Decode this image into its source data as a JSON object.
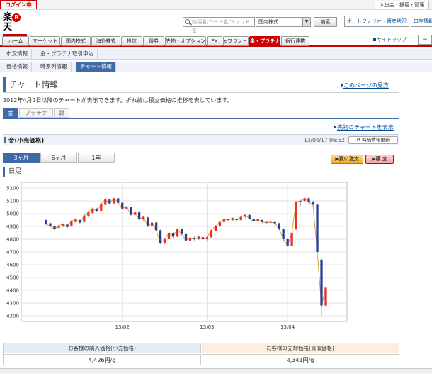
{
  "topbar": {
    "login": "ログイン中",
    "toplink": "入出金・振替・管理"
  },
  "header": {
    "logo_main": "楽",
    "logo_r": "R",
    "logo_end": "天",
    "search_placeholder": "銘柄名/コード名/ファンド名",
    "market_select": "国内株式",
    "search_button": "検索",
    "portfolio_tab": "ポートフォリオ・資産状況",
    "account_tab": "口座情報"
  },
  "nav": {
    "items": [
      "ホーム",
      "マーケット",
      "国内株式",
      "海外株式",
      "投信",
      "債券",
      "先物・オプション",
      "FX",
      "eワラント",
      "金・プラチナ",
      "銀行連携"
    ],
    "sitemap": "サイトマップ",
    "minimize": "−"
  },
  "subnav1": [
    "市況情報",
    "金・プラチナ取引申込"
  ],
  "subnav2": [
    "価格情報",
    "時系列情報",
    "チャート情報"
  ],
  "page": {
    "title": "チャート情報",
    "help_link": "このページの見方",
    "description": "2012年4月2日以降のチャートが表示できます。折れ線は積立価格の推移を表しています。"
  },
  "metal_tabs": [
    "金",
    "プラチナ",
    "銀"
  ],
  "futures_link": "先物のチャートを表示",
  "product": {
    "name": "金(小売価格)",
    "timestamp": "13/04/17 06:52",
    "refresh": "時価情報更新"
  },
  "period_tabs": [
    "3ヶ月",
    "6ヶ月",
    "1年"
  ],
  "buttons": {
    "buy": "買い注文",
    "accumulate": "積 立"
  },
  "chart_label": "日足",
  "chart_data": {
    "type": "candlestick",
    "ylim": [
      4200,
      5200
    ],
    "yticks": [
      4200,
      4300,
      4400,
      4500,
      4600,
      4700,
      4800,
      4900,
      5000,
      5100,
      5200
    ],
    "xlabels": [
      {
        "label": "13/02",
        "index": 18
      },
      {
        "label": "13/03",
        "index": 38
      },
      {
        "label": "13/04",
        "index": 57
      }
    ],
    "candles": [
      [
        4950,
        4920,
        4960,
        4910
      ],
      [
        4925,
        4900,
        4935,
        4890
      ],
      [
        4900,
        4880,
        4910,
        4870
      ],
      [
        4890,
        4905,
        4915,
        4880
      ],
      [
        4905,
        4920,
        4925,
        4895
      ],
      [
        4915,
        4895,
        4925,
        4885
      ],
      [
        4900,
        4940,
        4950,
        4895
      ],
      [
        4935,
        4955,
        4965,
        4925
      ],
      [
        4950,
        4930,
        4960,
        4920
      ],
      [
        4935,
        4985,
        4995,
        4930
      ],
      [
        4980,
        5010,
        5020,
        4970
      ],
      [
        5005,
        5040,
        5050,
        5000
      ],
      [
        5040,
        5020,
        5045,
        5010
      ],
      [
        5020,
        5075,
        5085,
        5015
      ],
      [
        5070,
        5110,
        5120,
        5065
      ],
      [
        5110,
        5080,
        5115,
        5070
      ],
      [
        5080,
        5120,
        5125,
        5075
      ],
      [
        5120,
        5085,
        5125,
        5075
      ],
      [
        5085,
        5040,
        5090,
        5030
      ],
      [
        5040,
        5055,
        5060,
        5030
      ],
      [
        5050,
        4990,
        5055,
        4985
      ],
      [
        4990,
        5010,
        5020,
        4980
      ],
      [
        5010,
        4955,
        5015,
        4950
      ],
      [
        4955,
        4975,
        4980,
        4945
      ],
      [
        4970,
        4900,
        4975,
        4895
      ],
      [
        4900,
        4930,
        4935,
        4890
      ],
      [
        4930,
        4870,
        4935,
        4860
      ],
      [
        4870,
        4770,
        4875,
        4760
      ],
      [
        4770,
        4800,
        4810,
        4760
      ],
      [
        4800,
        4850,
        4860,
        4795
      ],
      [
        4845,
        4820,
        4855,
        4810
      ],
      [
        4820,
        4880,
        4885,
        4815
      ],
      [
        4880,
        4840,
        4885,
        4830
      ],
      [
        4840,
        4790,
        4845,
        4780
      ],
      [
        4790,
        4810,
        4815,
        4785
      ],
      [
        4810,
        4800,
        4820,
        4790
      ],
      [
        4800,
        4820,
        4830,
        4795
      ],
      [
        4815,
        4800,
        4825,
        4795
      ],
      [
        4800,
        4815,
        4825,
        4790
      ],
      [
        4815,
        4870,
        4880,
        4810
      ],
      [
        4865,
        4900,
        4910,
        4860
      ],
      [
        4900,
        4935,
        4945,
        4895
      ],
      [
        4935,
        4955,
        4965,
        4925
      ],
      [
        4955,
        4950,
        4960,
        4940
      ],
      [
        4950,
        4965,
        4970,
        4940
      ],
      [
        4960,
        4950,
        4970,
        4940
      ],
      [
        4950,
        4975,
        4980,
        4940
      ],
      [
        4975,
        4990,
        5000,
        4965
      ],
      [
        4990,
        4960,
        4995,
        4955
      ],
      [
        4960,
        4940,
        4965,
        4930
      ],
      [
        4940,
        4955,
        4960,
        4935
      ],
      [
        4950,
        4935,
        4960,
        4925
      ],
      [
        4935,
        4930,
        4945,
        4920
      ],
      [
        4930,
        4935,
        4945,
        4920
      ],
      [
        4935,
        4925,
        4940,
        4920
      ],
      [
        4925,
        4880,
        4930,
        4870
      ],
      [
        4880,
        4800,
        4885,
        4780
      ],
      [
        4800,
        4750,
        4810,
        4740
      ],
      [
        4750,
        4850,
        4860,
        4745
      ],
      [
        4880,
        5090,
        5100,
        4870
      ],
      [
        5090,
        5100,
        5110,
        5060
      ],
      [
        5100,
        5120,
        5130,
        5090
      ],
      [
        5120,
        5090,
        5130,
        5070
      ],
      [
        5090,
        5070,
        5100,
        5060
      ],
      [
        5070,
        4700,
        5080,
        4690
      ],
      [
        4640,
        4280,
        4650,
        4200
      ],
      [
        4280,
        4420,
        4430,
        4270
      ]
    ]
  },
  "price_table": {
    "buy_header": "お客様の購入価格(小売価格)",
    "sell_header": "お客様の売却価格(買取価格)",
    "buy_value": "4,426円/g",
    "sell_value": "4,341円/g"
  }
}
